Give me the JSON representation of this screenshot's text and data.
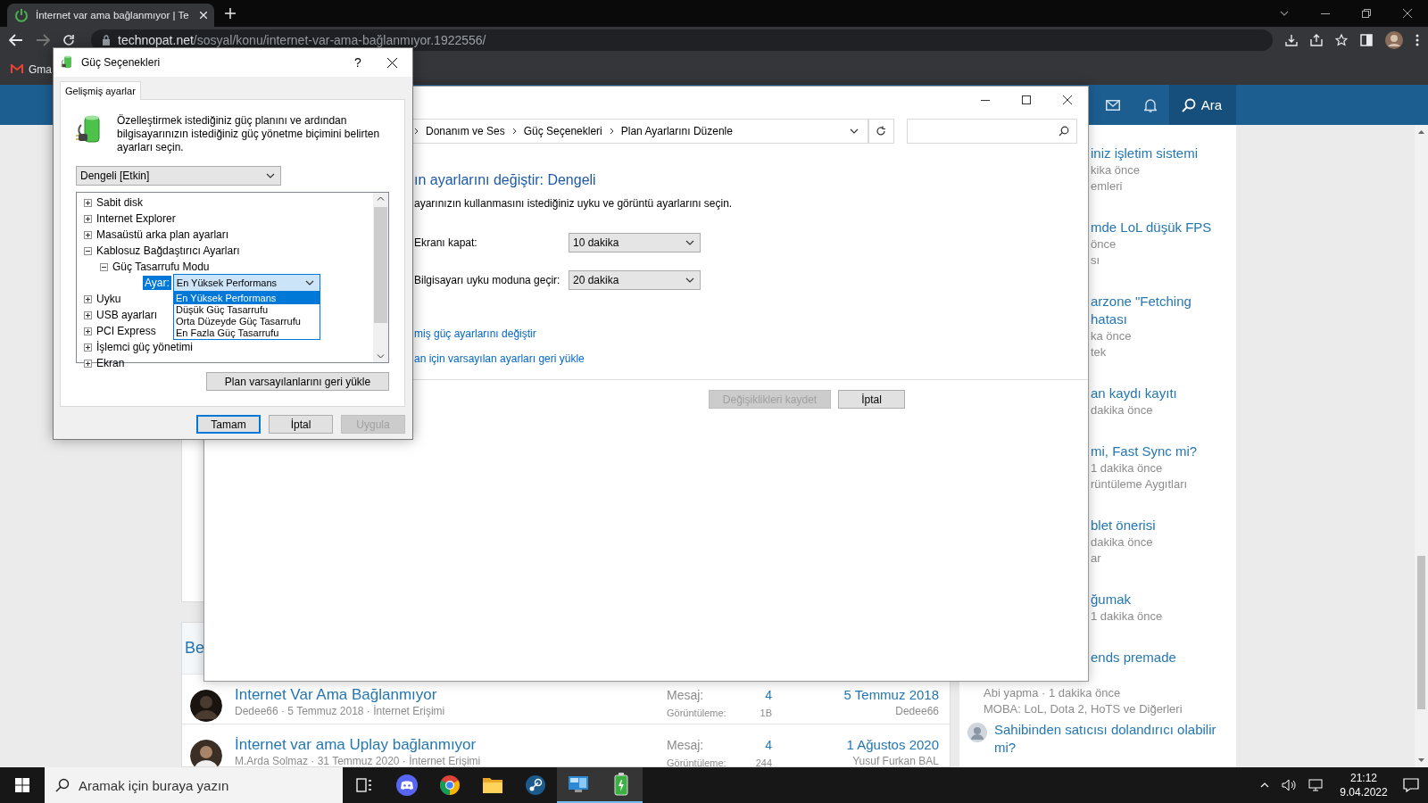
{
  "browser": {
    "tab": {
      "title": "İnternet var ama bağlanmıyor | Te",
      "selected": true
    },
    "address_bar": {
      "host": "technopat.net",
      "path": "/sosyal/konu/internet-var-ama-bağlanmıyor.1922556/"
    },
    "bookmarks": [
      {
        "label": "Gma"
      }
    ],
    "site_header": {
      "search_label": "Ara"
    },
    "thread_list": {
      "heading": "Be",
      "rows": [
        {
          "title": "Internet Var Ama Bağlanmıyor",
          "meta": "Dedee66 · 5 Temmuz 2018 · İnternet Erişimi",
          "messages_label": "Mesaj:",
          "messages": "4",
          "views_label": "Görüntüleme:",
          "views": "1B",
          "last_date": "5 Temmuz 2018",
          "last_user": "Dedee66"
        },
        {
          "title": "İnternet var ama Uplay bağlanmıyor",
          "meta": "M.Arda Solmaz · 31 Temmuz 2020 · İnternet Erişimi",
          "messages_label": "Mesaj:",
          "messages": "4",
          "views_label": "Görüntüleme:",
          "views": "244",
          "last_date": "1 Ağustos 2020",
          "last_user": "Yusuf Furkan BAL"
        }
      ]
    },
    "sidebar": {
      "items": [
        {
          "title": [
            "iniz işletim sistemi"
          ],
          "meta": [
            "kika önce",
            "emleri"
          ]
        },
        {
          "title": [
            "mde LoL düşük FPS"
          ],
          "meta": [
            "önce",
            "sı"
          ]
        },
        {
          "title": [
            "arzone \"Fetching",
            "hatası"
          ],
          "meta": [
            "ka önce",
            "tek"
          ]
        },
        {
          "title": [
            "an kaydı kayıtı"
          ],
          "meta": [
            "dakika önce"
          ]
        },
        {
          "title": [
            "mi, Fast Sync mi?"
          ],
          "meta": [
            "1 dakika önce",
            "rüntüleme Aygıtları"
          ]
        },
        {
          "title": [
            "blet önerisi"
          ],
          "meta": [
            "dakika önce",
            "ar"
          ]
        },
        {
          "title": [
            "ğumak"
          ],
          "meta": [
            "1 dakika önce"
          ]
        },
        {
          "title": [
            "ends premade"
          ]
        }
      ],
      "continued_meta": [
        "Abi yapma · 1 dakika önce",
        "MOBA: LoL, Dota 2, HoTS ve Diğerleri"
      ],
      "next_item": {
        "title": "Sahibinden satıcısı dolandırıcı olabilir mi?"
      }
    }
  },
  "control_panel": {
    "breadcrumb": [
      "Donanım ve Ses",
      "Güç Seçenekleri",
      "Plan Ayarlarını Düzenle"
    ],
    "heading": "ın ayarlarını değiştir: Dengeli",
    "description": "ayarınızın kullanmasını istediğiniz uyku ve görüntü ayarlarını seçin.",
    "settings": [
      {
        "label": "Ekranı kapat:",
        "value": "10 dakika"
      },
      {
        "label": "Bilgisayarı uyku moduna geçir:",
        "value": "20 dakika"
      }
    ],
    "links": [
      "miş güç ayarlarını değiştir",
      "an için varsayılan ayarları geri yükle"
    ],
    "buttons": [
      {
        "label": "Değişiklikleri kaydet",
        "disabled": true
      },
      {
        "label": "İptal",
        "disabled": false
      }
    ]
  },
  "power_dialog": {
    "title": "Güç Seçenekleri",
    "help": "?",
    "tabs": [
      {
        "label": "Gelişmiş ayarlar",
        "selected": true
      }
    ],
    "intro": "Özelleştirmek istediğiniz güç planını ve ardından bilgisayarınızın istediğiniz güç yönetme biçimini belirten ayarları seçin.",
    "plan": "Dengeli [Etkin]",
    "tree": [
      {
        "label": "Sabit disk",
        "expanded": false
      },
      {
        "label": "Internet Explorer",
        "expanded": false
      },
      {
        "label": "Masaüstü arka plan ayarları",
        "expanded": false
      },
      {
        "label": "Kablosuz Bağdaştırıcı Ayarları",
        "expanded": true,
        "children": [
          {
            "label": "Güç Tasarrufu Modu",
            "expanded": true,
            "setting": {
              "label": "Ayar:",
              "value": "En Yüksek Performans",
              "open": true,
              "options": [
                {
                  "label": "En Yüksek Performans",
                  "selected": true
                },
                {
                  "label": "Düşük Güç Tasarrufu",
                  "selected": false
                },
                {
                  "label": "Orta Düzeyde Güç Tasarrufu",
                  "selected": false
                },
                {
                  "label": "En Fazla Güç Tasarrufu",
                  "selected": false
                }
              ]
            }
          }
        ]
      },
      {
        "label": "Uyku",
        "expanded": false
      },
      {
        "label": "USB ayarları",
        "expanded": false
      },
      {
        "label": "PCI Express",
        "expanded": false
      },
      {
        "label": "İşlemci güç yönetimi",
        "expanded": false
      },
      {
        "label": "Ekran",
        "expanded": false
      }
    ],
    "restore_button": "Plan varsayılanlarını geri yükle",
    "buttons": [
      {
        "label": "Tamam",
        "focused": true,
        "disabled": false
      },
      {
        "label": "İptal",
        "focused": false,
        "disabled": false
      },
      {
        "label": "Uygula",
        "focused": false,
        "disabled": true
      }
    ]
  },
  "taskbar": {
    "search_placeholder": "Aramak için buraya yazın",
    "apps": [
      {
        "kind": "task-view",
        "active": false
      },
      {
        "kind": "discord",
        "active": false
      },
      {
        "kind": "chrome",
        "active": false
      },
      {
        "kind": "explorer",
        "active": false
      },
      {
        "kind": "steam",
        "active": false
      },
      {
        "kind": "control-panel",
        "active": true
      },
      {
        "kind": "power",
        "active": true
      }
    ],
    "clock": {
      "time": "21:12",
      "date": "9.04.2022"
    }
  }
}
